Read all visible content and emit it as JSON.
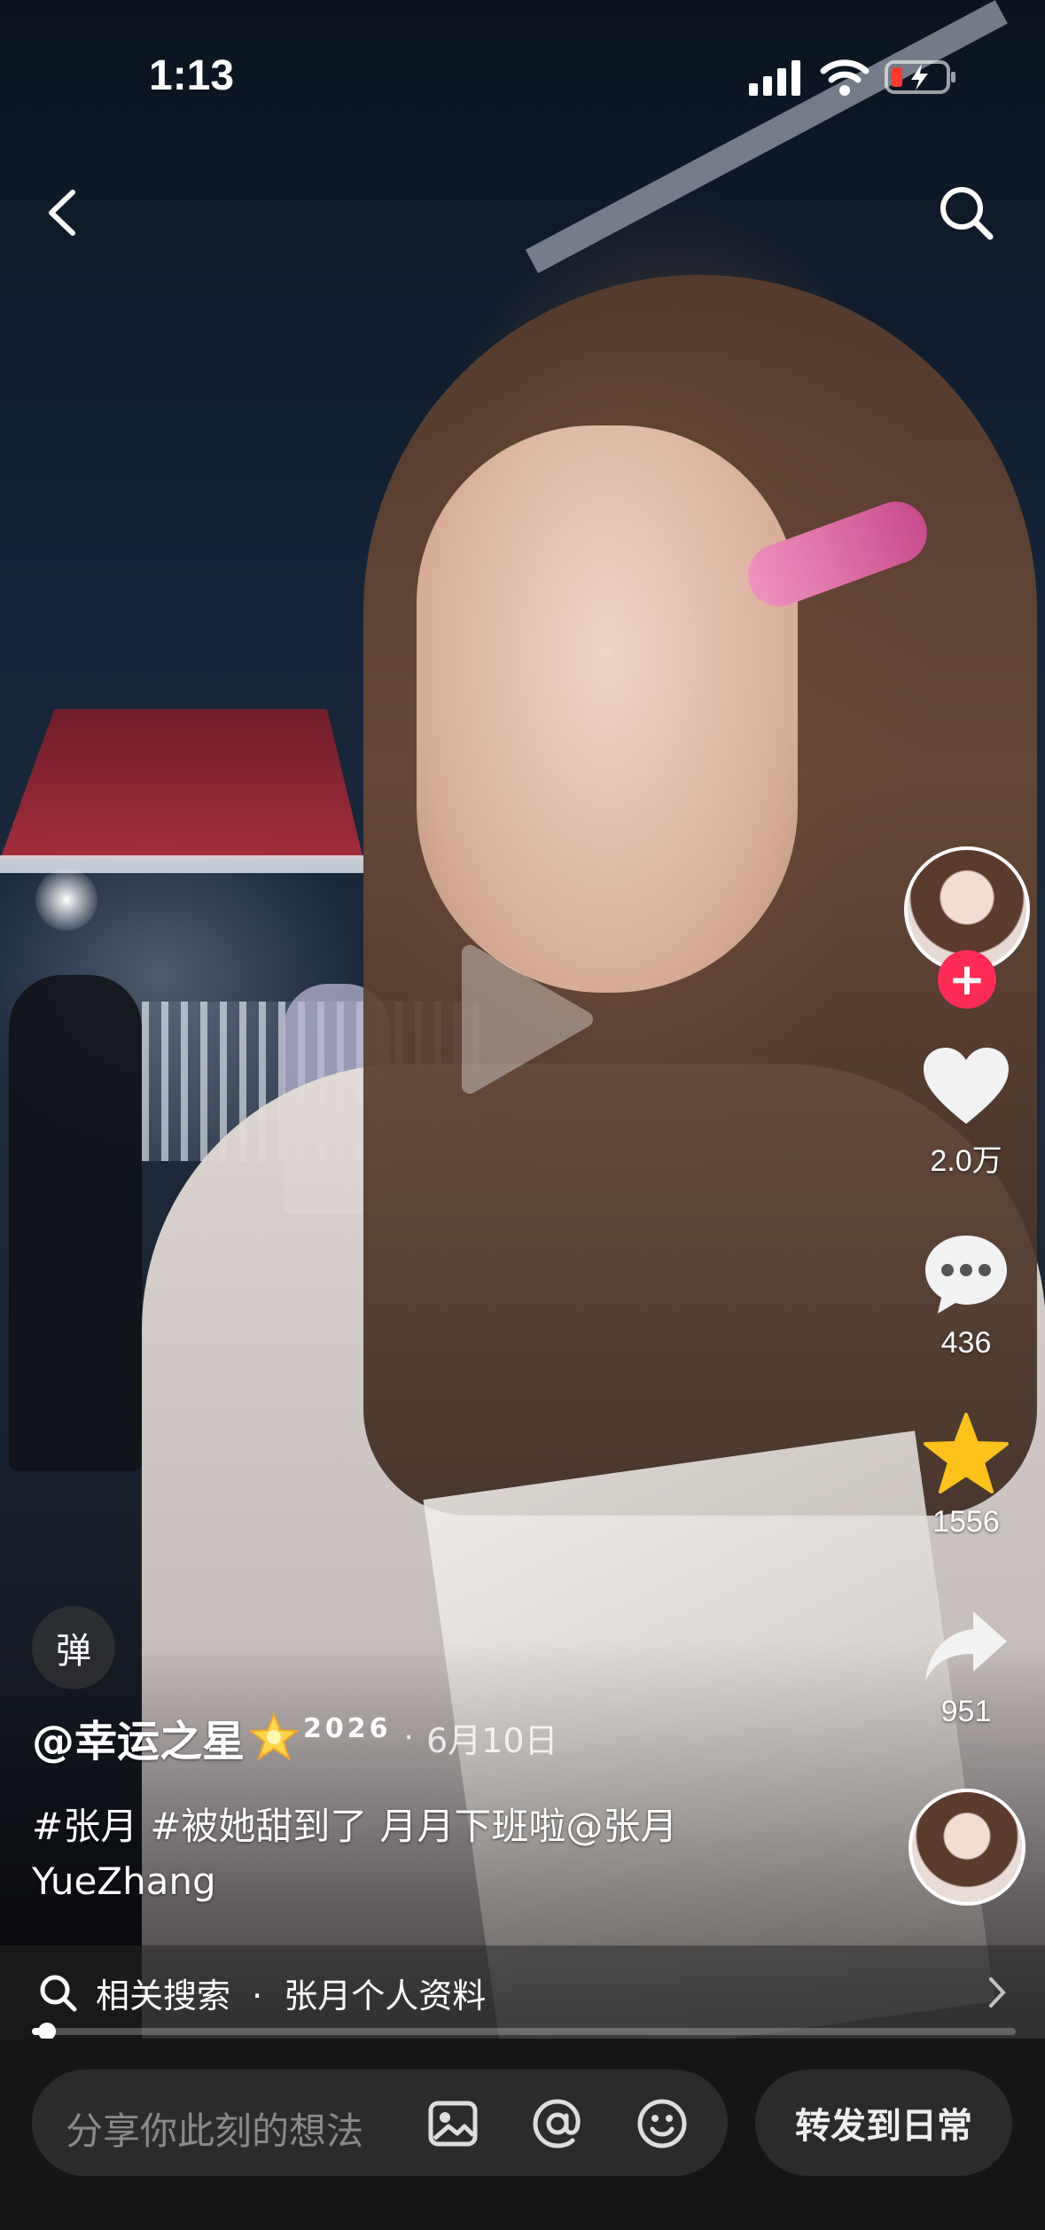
{
  "status_bar": {
    "time": "1:13"
  },
  "rail": {
    "likes": "2.0万",
    "comments": "436",
    "favorites": "1556",
    "shares": "951"
  },
  "danmu_label": "弹",
  "post": {
    "author": "@幸运之星",
    "badge_year": "2026",
    "separator": "·",
    "date": "6月10日",
    "hashtags": [
      "#张月",
      "#被她甜到了"
    ],
    "caption_text": "月月下班啦@张月YueZhang"
  },
  "related": {
    "label": "相关搜索",
    "separator": "·",
    "query": "张月个人资料"
  },
  "progress": {
    "fraction": 0.015
  },
  "bottom": {
    "input_placeholder": "分享你此刻的想法",
    "share_label": "转发到日常"
  },
  "icons": {
    "back": "chevron-left-icon",
    "search": "search-icon",
    "like": "heart-icon",
    "comment": "comment-bubble-icon",
    "favorite": "star-icon",
    "share": "share-arrow-icon",
    "image": "image-icon",
    "mention": "at-icon",
    "emoji": "smile-icon"
  },
  "colors": {
    "follow": "#fe2c55",
    "star": "#ffc21a",
    "battery_low": "#ff3b30"
  }
}
